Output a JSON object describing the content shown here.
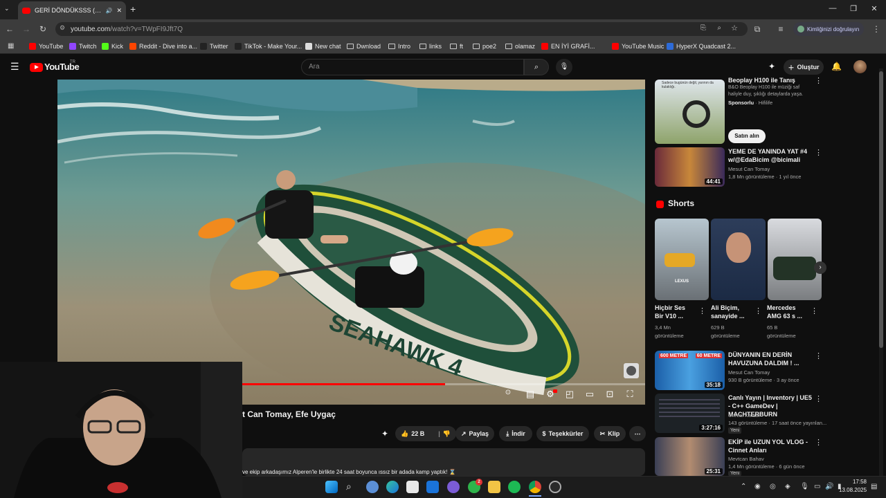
{
  "browser": {
    "tab_title": "GERİ DÖNDÜKSSS (her şey",
    "url_host": "youtube.com",
    "url_path": "/watch?v=TWpFI9Jft7Q",
    "profile_label": "Kimliğinizi doğrulayın",
    "bookmarks": [
      "YouTube",
      "Twitch",
      "Kick",
      "Reddit - Dive into a...",
      "Twitter",
      "TikTok - Make Your...",
      "New chat",
      "Dwnload",
      "Intro",
      "links",
      "ft",
      "poe2",
      "olamaz",
      "EN İYİ GRAFİ...",
      "YouTube Music",
      "HyperX Quadcast 2..."
    ]
  },
  "youtube": {
    "logo": "YouTube",
    "logo_region": "TR",
    "search_placeholder": "Ara",
    "create_label": "Oluştur"
  },
  "video": {
    "boat_text": "SEAHAWK 4",
    "title_visible": "t Can Tomay, Efe Uygaç",
    "likes": "22 B",
    "share": "Paylaş",
    "download": "İndir",
    "thanks": "Teşekkürler",
    "clip": "Klip",
    "description": "ve ekip arkadaşımız Alperen'le birlikte 24 saat boyunca ıssız bir adada kamp yaptık! ⌛"
  },
  "sidebar": {
    "ad": {
      "title": "Beoplay H100 ile Tanış",
      "desc": "B&O Beoplay H100 ile müziği saf haliyle duy, şıklığı detaylarda yaşa.",
      "sponsor": "Sponsorlu",
      "sponsor_name": "Hifilife",
      "cta": "Satın alın",
      "thumb_text": "Sadece bugünün değil, yarının da kulaklığı."
    },
    "v1": {
      "title": "YEME DE YANINDA YAT #4 w/@EdaBicim @bicimali",
      "channel": "Mesut Can Tomay",
      "meta": "1,8 Mn görüntüleme · 1 yıl önce",
      "duration": "44:41"
    },
    "shorts_heading": "Shorts",
    "shorts": [
      {
        "title": "Hiçbir Ses Bir V10 ...",
        "views": "3,4 Mn",
        "views2": "görüntüleme",
        "overlay": "LEXUS"
      },
      {
        "title": "Ali Biçim, sanayide ...",
        "views": "629 B",
        "views2": "görüntüleme"
      },
      {
        "title": "Mercedes AMG 63 s ...",
        "views": "65 B",
        "views2": "görüntüleme"
      }
    ],
    "v2": {
      "title": "DÜNYANIN EN DERİN HAVUZUNA DALDIM ! ...",
      "channel": "Mesut Can Tomay",
      "meta": "930 B görüntüleme · 3 ay önce",
      "duration": "35:18",
      "overlay1": "600 METRE",
      "overlay2": "60 METRE"
    },
    "v3": {
      "title": "Canlı Yayın | Inventory | UE5 - C++ GameDev | MACHTERBURN",
      "channel": "Unreal Kafası",
      "meta": "143 görüntüleme · 17 saat önce yayınlan...",
      "duration": "3:27:16",
      "badge": "Yeni"
    },
    "v4": {
      "title": "EKİP ile UZUN YOL VLOG - Cinnet Anları",
      "channel": "Mevtcan Bahav",
      "meta": "1,4 Mn görüntüleme · 6 gün önce",
      "duration": "25:31",
      "badge": "Yeni"
    }
  },
  "taskbar": {
    "time": "17:58",
    "date": "13.08.2025",
    "xbox_badge": "2"
  },
  "colors": {
    "yt_red": "#ff0000",
    "bg": "#0f0f0f"
  }
}
